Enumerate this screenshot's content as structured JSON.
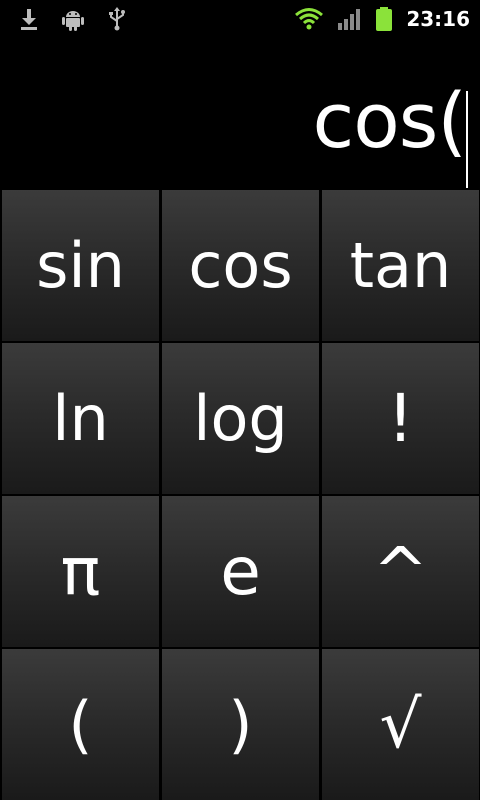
{
  "status_bar": {
    "time": "23:16",
    "icons": [
      "download-icon",
      "android-debug-icon",
      "usb-icon",
      "wifi-icon",
      "signal-icon",
      "battery-icon"
    ],
    "battery_color": "#8BE23A",
    "wifi_color": "#8BE23A"
  },
  "display": {
    "expression": "cos("
  },
  "keypad": {
    "keys": [
      {
        "label": "sin"
      },
      {
        "label": "cos"
      },
      {
        "label": "tan"
      },
      {
        "label": "ln"
      },
      {
        "label": "log"
      },
      {
        "label": "!"
      },
      {
        "label": "π"
      },
      {
        "label": "e"
      },
      {
        "label": "^"
      },
      {
        "label": "("
      },
      {
        "label": ")"
      },
      {
        "label": "√"
      }
    ]
  }
}
